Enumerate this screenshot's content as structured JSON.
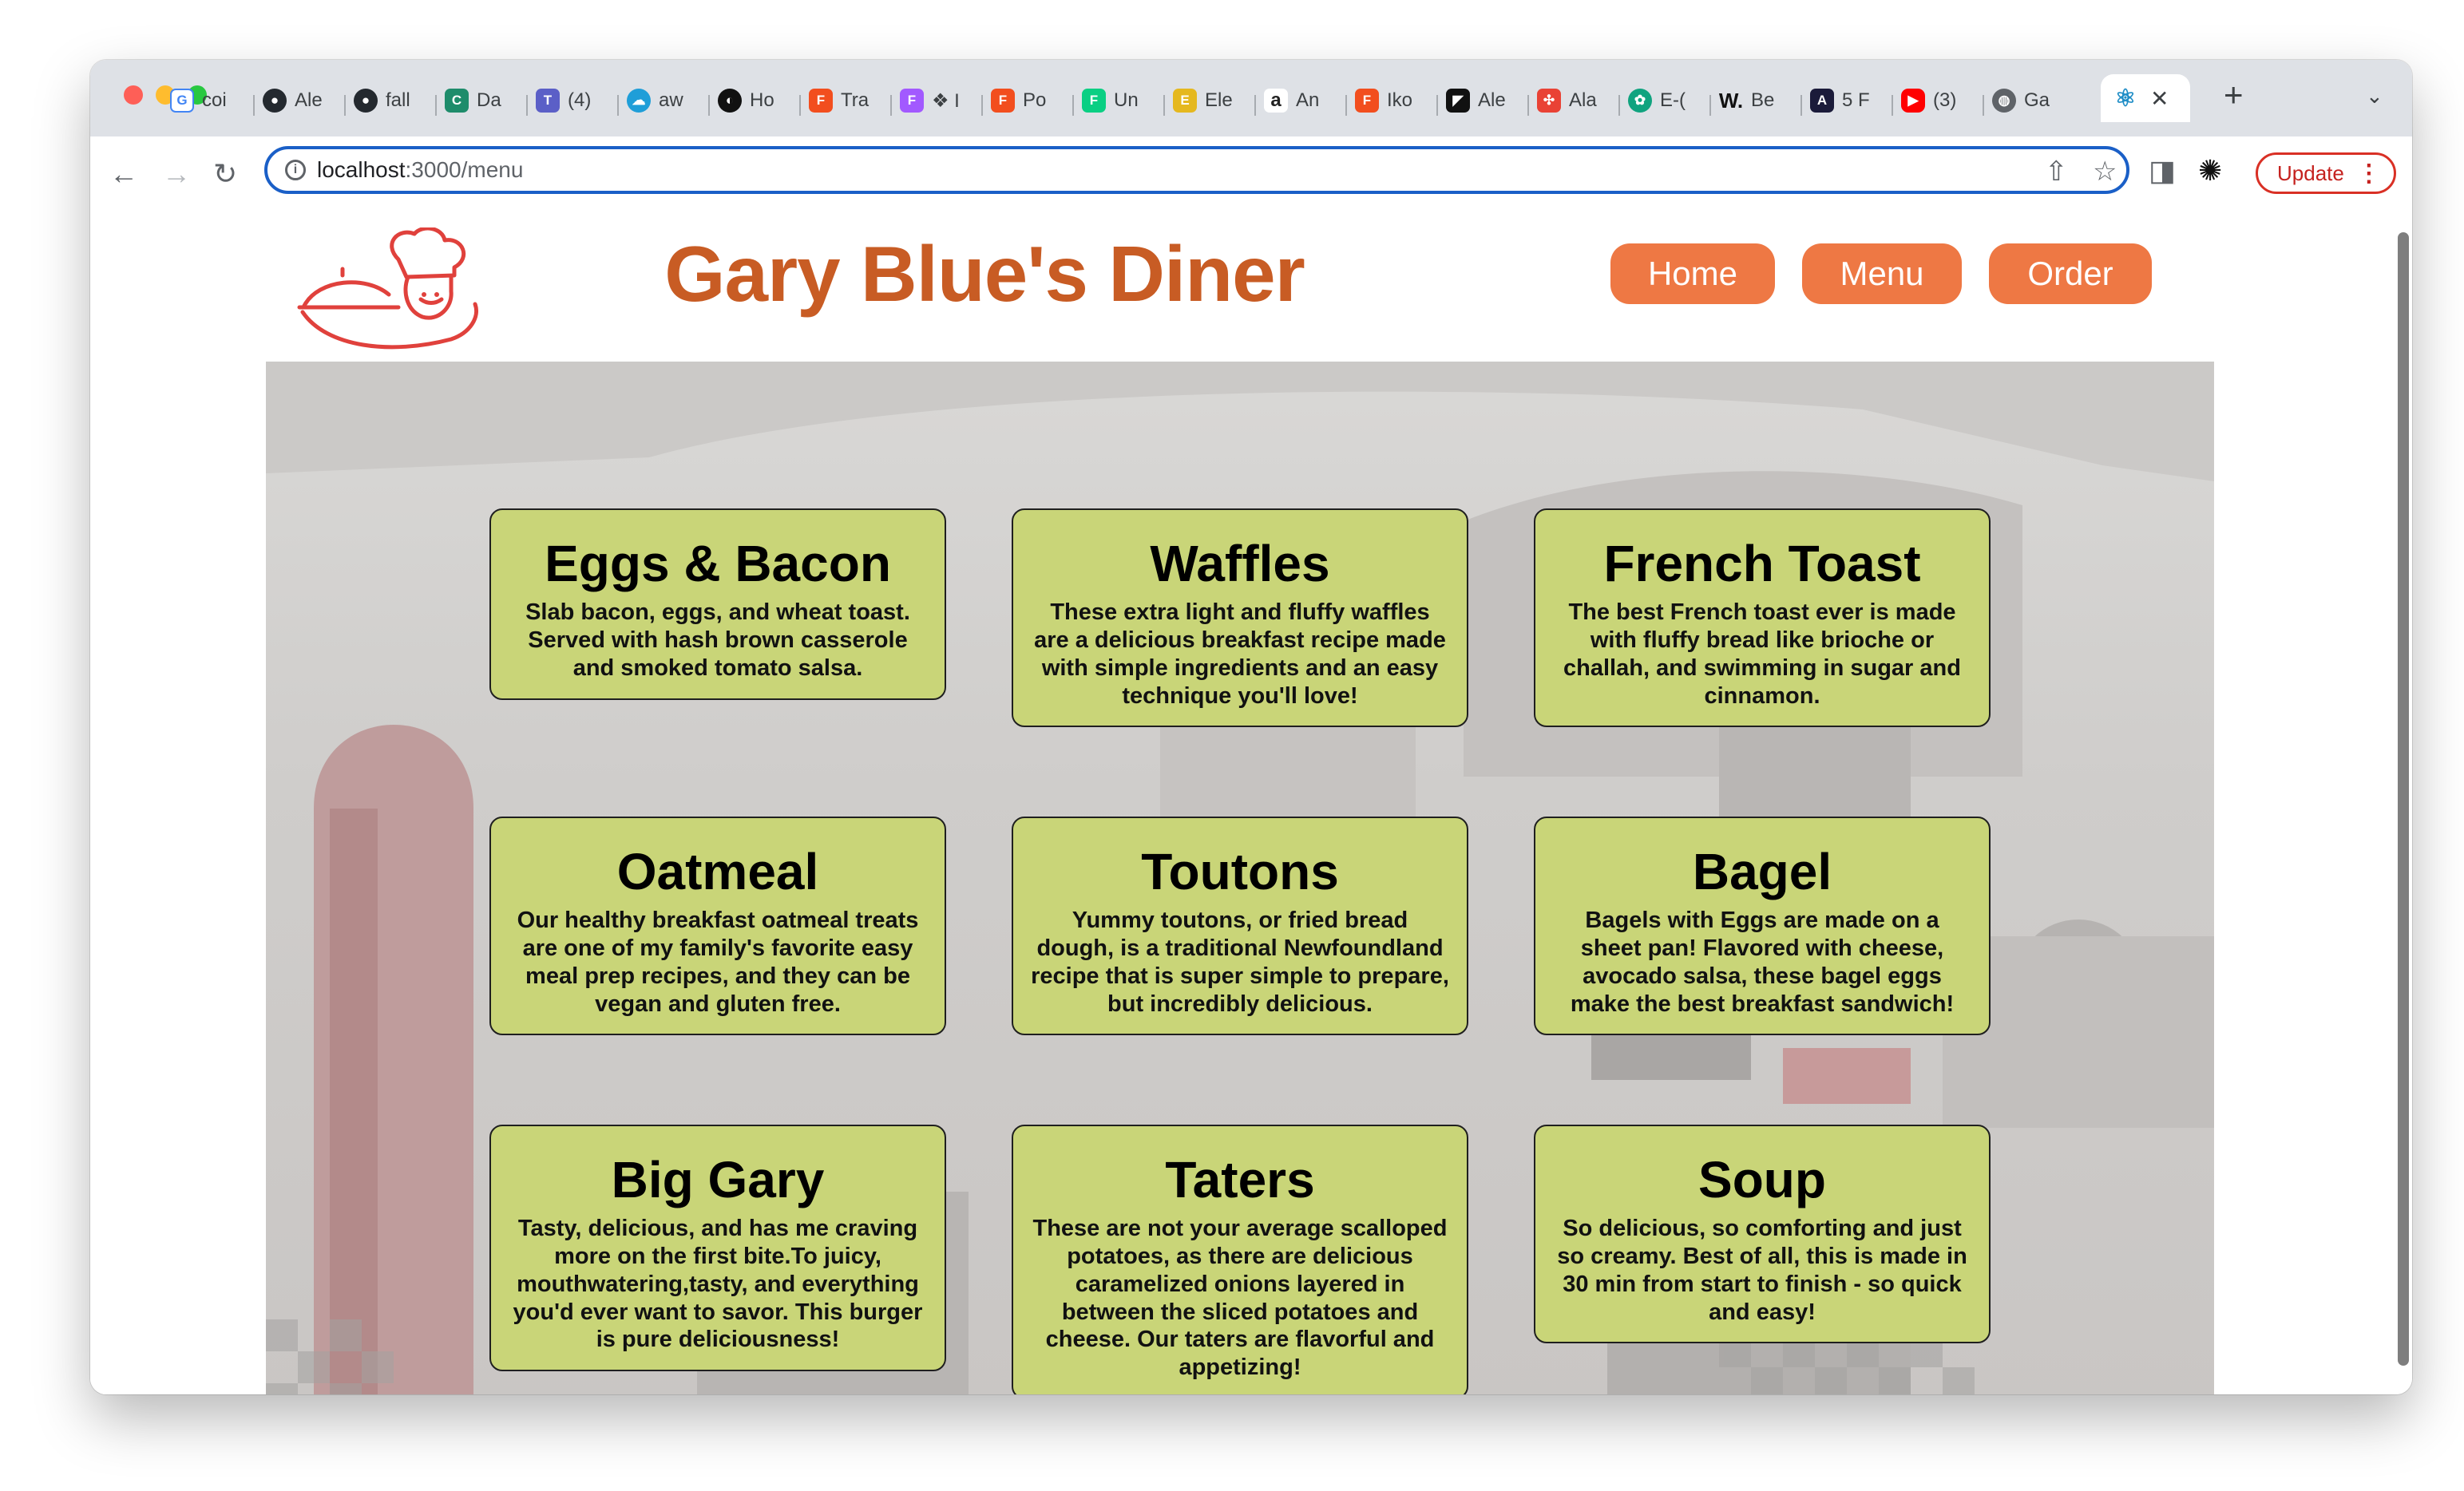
{
  "browser": {
    "tabs": [
      {
        "icon": "google-icon",
        "label": "coi",
        "color": "#4285f4"
      },
      {
        "icon": "github-icon",
        "label": "Ale",
        "color": "#24292f"
      },
      {
        "icon": "github-icon",
        "label": "fall",
        "color": "#24292f"
      },
      {
        "icon": "codepen-icon",
        "label": "Da",
        "color": "#1e8c6b"
      },
      {
        "icon": "teams-icon",
        "label": "(4)",
        "color": "#5b5fc7"
      },
      {
        "icon": "salesforce-icon",
        "label": "aw",
        "color": "#1f9ed8"
      },
      {
        "icon": "hotjar-icon",
        "label": "Ho",
        "color": "#111111"
      },
      {
        "icon": "figma-icon",
        "label": "Tra",
        "color": "#f24e1e"
      },
      {
        "icon": "figma-icon",
        "label": "❖ I",
        "color": "#a259ff"
      },
      {
        "icon": "figma-icon",
        "label": "Po",
        "color": "#f24e1e"
      },
      {
        "icon": "figma-icon",
        "label": "Un",
        "color": "#0acf83"
      },
      {
        "icon": "elementor-icon",
        "label": "Ele",
        "color": "#e5b81f"
      },
      {
        "icon": "amazon-icon",
        "label": "An",
        "color": "#222222"
      },
      {
        "icon": "figma-icon",
        "label": "Iko",
        "color": "#f24e1e"
      },
      {
        "icon": "framer-icon",
        "label": "Ale",
        "color": "#111111"
      },
      {
        "icon": "puzzle-icon",
        "label": "Ala",
        "color": "#e94235"
      },
      {
        "icon": "chatgpt-icon",
        "label": "E-(",
        "color": "#10a37f"
      },
      {
        "icon": "webflow-icon",
        "label": "Be",
        "color": "#111111"
      },
      {
        "icon": "ae-icon",
        "label": "5 F",
        "color": "#1b1b3a"
      },
      {
        "icon": "youtube-icon",
        "label": "(3)",
        "color": "#ff0000"
      },
      {
        "icon": "globe-icon",
        "label": "Ga",
        "color": "#5f6368"
      }
    ],
    "active_tab_icon": "react-icon",
    "url_host": "localhost",
    "url_path": ":3000/menu",
    "update_label": "Update"
  },
  "site": {
    "title": "Gary Blue's Diner",
    "logo": "chef-waiter-logo",
    "nav": [
      "Home",
      "Menu",
      "Order"
    ]
  },
  "menu_items": [
    {
      "name": "Eggs & Bacon",
      "desc": "Slab bacon, eggs, and wheat toast. Served with hash brown casserole and smoked tomato salsa."
    },
    {
      "name": "Waffles",
      "desc": "These extra light and fluffy waffles are a delicious breakfast recipe made with simple ingredients and an easy technique you'll love!"
    },
    {
      "name": "French Toast",
      "desc": "The best French toast ever is made with fluffy bread like brioche or challah, and swimming in sugar and cinnamon."
    },
    {
      "name": "Oatmeal",
      "desc": "Our healthy breakfast oatmeal treats are one of my family's favorite easy meal prep recipes, and they can be vegan and gluten free."
    },
    {
      "name": "Toutons",
      "desc": "Yummy toutons, or fried bread dough, is a traditional Newfoundland recipe that is super simple to prepare, but incredibly delicious."
    },
    {
      "name": "Bagel",
      "desc": "Bagels with Eggs are made on a sheet pan! Flavored with cheese, avocado salsa, these bagel eggs make the best breakfast sandwich!"
    },
    {
      "name": "Big Gary",
      "desc": "Tasty, delicious, and has me craving more on the first bite.To juicy, mouthwatering,tasty, and everything you'd ever want to savor. This burger is pure deliciousness!"
    },
    {
      "name": "Taters",
      "desc": "These are not your average scalloped potatoes, as there are delicious caramelized onions layered in between the sliced potatoes and cheese. Our taters are flavorful and appetizing!"
    },
    {
      "name": "Soup",
      "desc": "So delicious, so comforting and just so creamy. Best of all, this is made in 30 min from start to finish - so quick and easy!"
    }
  ],
  "colors": {
    "title": "#c85c24",
    "nav_button": "#ee7844",
    "card_bg": "#c9d578"
  }
}
